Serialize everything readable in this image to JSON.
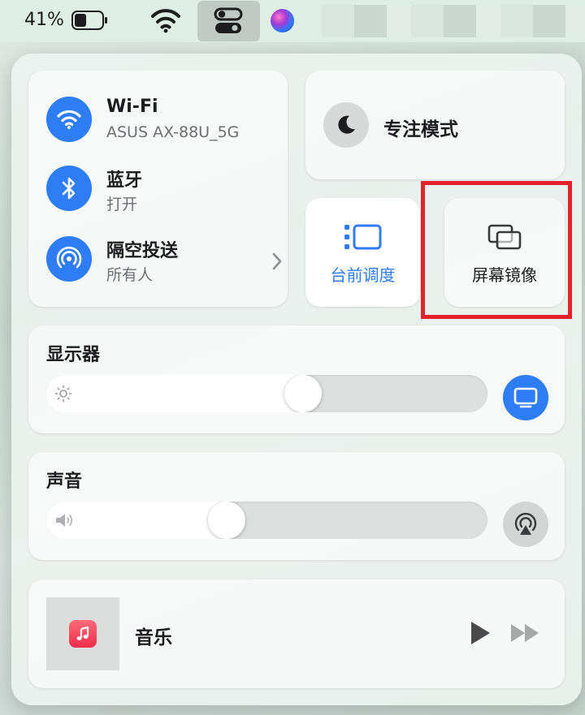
{
  "menubar": {
    "battery_percent": "41%",
    "battery_level": 0.41,
    "icons": [
      "battery-icon",
      "wifi-icon",
      "control-center-icon",
      "siri-icon"
    ]
  },
  "network": {
    "wifi": {
      "title": "Wi-Fi",
      "subtitle": "ASUS AX-88U_5G",
      "icon": "wifi-icon"
    },
    "bluetooth": {
      "title": "蓝牙",
      "subtitle": "打开",
      "icon": "bluetooth-icon"
    },
    "airdrop": {
      "title": "隔空投送",
      "subtitle": "所有人",
      "icon": "airdrop-icon"
    }
  },
  "focus": {
    "label": "专注模式",
    "icon": "moon-icon"
  },
  "stage_manager": {
    "label": "台前调度",
    "icon": "stage-manager-icon"
  },
  "screen_mirroring": {
    "label": "屏幕镜像",
    "icon": "screen-mirroring-icon"
  },
  "display": {
    "title": "显示器",
    "brightness": 0.59,
    "icon": "display-icon"
  },
  "sound": {
    "title": "声音",
    "volume": 0.4,
    "icon": "airplay-audio-icon"
  },
  "music": {
    "title": "音乐",
    "icon": "music-app-icon"
  },
  "colors": {
    "accent": "#2f7df6",
    "highlight": "#e4222c"
  }
}
